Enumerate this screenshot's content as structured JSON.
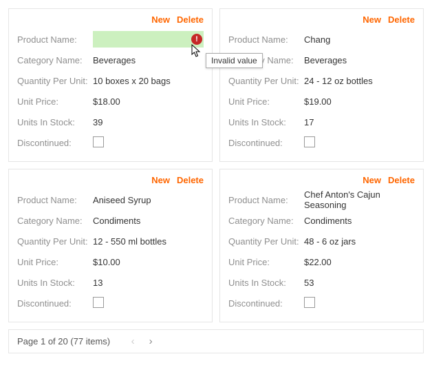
{
  "actions": {
    "new": "New",
    "delete": "Delete"
  },
  "labels": {
    "productName": "Product Name:",
    "categoryName": "Category Name:",
    "quantityPerUnit": "Quantity Per Unit:",
    "unitPrice": "Unit Price:",
    "unitsInStock": "Units In Stock:",
    "discontinued": "Discontinued:"
  },
  "tooltip": "Invalid value",
  "cards": [
    {
      "productName": "",
      "editing": true,
      "categoryName": "Beverages",
      "quantityPerUnit": "10 boxes x 20 bags",
      "unitPrice": "$18.00",
      "unitsInStock": "39"
    },
    {
      "productName": "Chang",
      "categoryName": "Beverages",
      "quantityPerUnit": "24 - 12 oz bottles",
      "unitPrice": "$19.00",
      "unitsInStock": "17"
    },
    {
      "productName": "Aniseed Syrup",
      "categoryName": "Condiments",
      "quantityPerUnit": "12 - 550 ml bottles",
      "unitPrice": "$10.00",
      "unitsInStock": "13"
    },
    {
      "productName": "Chef Anton's Cajun Seasoning",
      "categoryName": "Condiments",
      "quantityPerUnit": "48 - 6 oz jars",
      "unitPrice": "$22.00",
      "unitsInStock": "53"
    }
  ],
  "pager": {
    "info": "Page 1 of 20 (77 items)",
    "prevGlyph": "‹",
    "nextGlyph": "›"
  }
}
